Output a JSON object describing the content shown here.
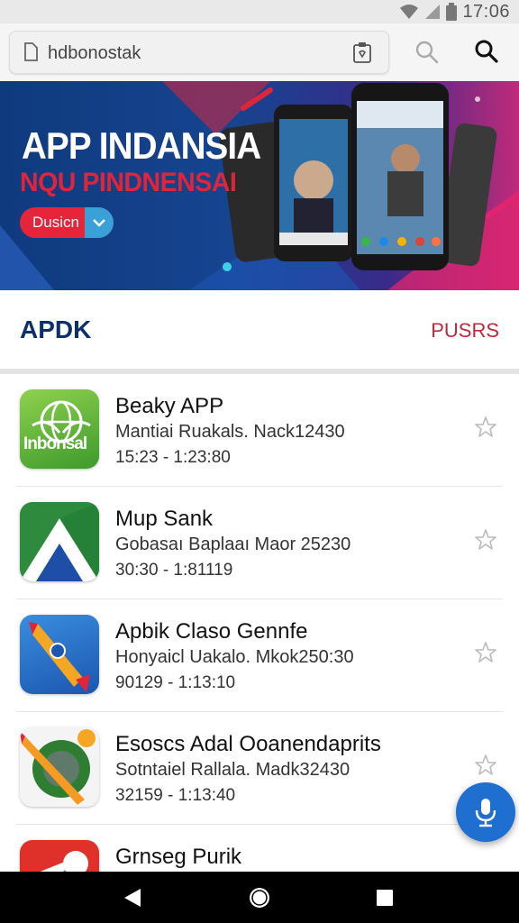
{
  "status_bar": {
    "time": "17:06",
    "icons": [
      "wifi-icon",
      "battery-icon"
    ]
  },
  "toolbar": {
    "url_text": "hdbonostak",
    "icons": [
      "document-icon",
      "clipboard-badge-icon",
      "search-icon",
      "search-icon"
    ]
  },
  "banner": {
    "title": "APP INDANSIA",
    "subtitle": "NQU PINDNENSAI",
    "button_label": "Dusicn",
    "colors": {
      "background": "#16448f",
      "accent": "#e0253a",
      "button_secondary": "#3aa0d8"
    }
  },
  "section": {
    "title": "APDK",
    "action": "PUSRS"
  },
  "apps": [
    {
      "name": "Beaky APP",
      "desc": "Mantiai Ruakals. Nack12430",
      "meta": "15:23 - 1:23:80",
      "icon": "globe-icon",
      "icon_label": "Inbonsal"
    },
    {
      "name": "Mup Sank",
      "desc": "Gobasaı Baplaaı Maor 25230",
      "meta": "30:30 - 1:81119",
      "icon": "triangle-logo-icon"
    },
    {
      "name": "Apbik Claso Gennfe",
      "desc": "Honyaicl Uakalo. Mkok250:30",
      "meta": "90129 - 1:13:10",
      "icon": "rocket-icon"
    },
    {
      "name": "Esoscs Adal Ooanendaprits",
      "desc": "Sotntaiel Rallala. Madk32430",
      "meta": "32159 - 1:13:40",
      "icon": "pencil-chat-icon"
    },
    {
      "name": "Grnseg Purik",
      "desc": "",
      "meta": "",
      "icon": "red-app-icon"
    }
  ],
  "fab": {
    "icon": "microphone-icon",
    "color": "#1e6fd0"
  },
  "nav": {
    "icons": [
      "back-icon",
      "home-icon",
      "recent-apps-icon"
    ]
  }
}
